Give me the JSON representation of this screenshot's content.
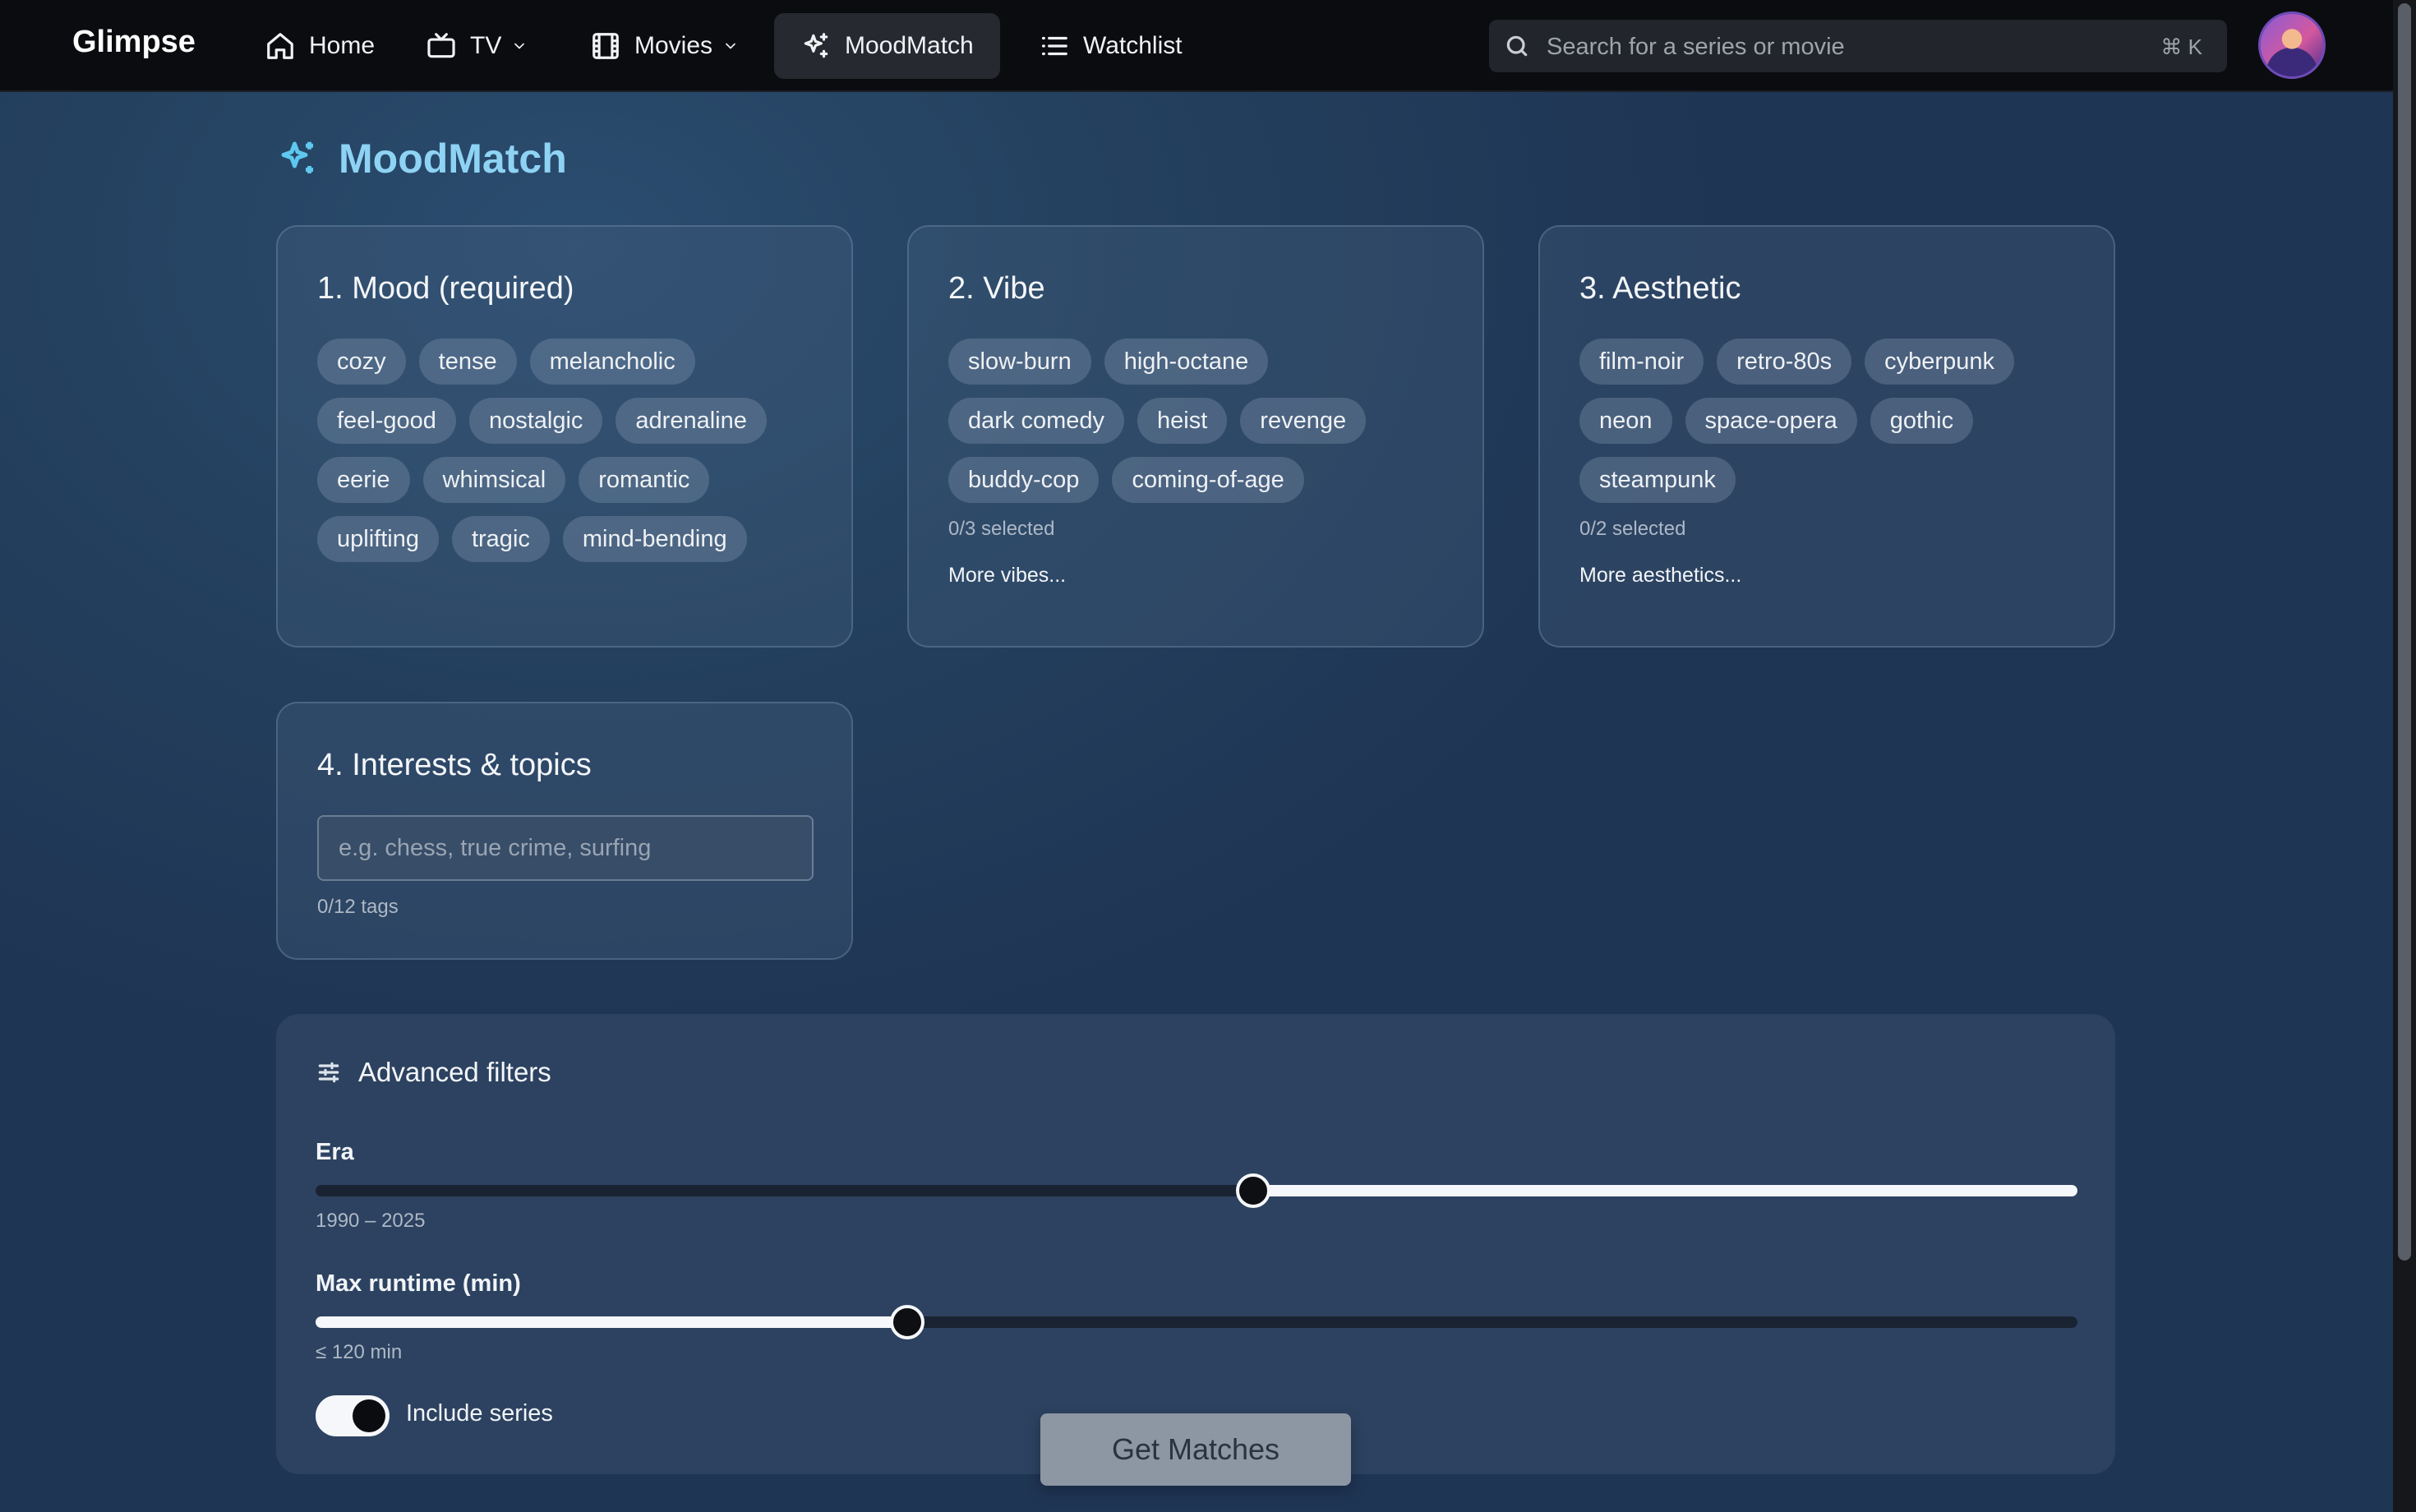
{
  "app": {
    "brand": "Glimpse"
  },
  "nav": {
    "items": [
      {
        "label": "Home",
        "icon": "home-icon"
      },
      {
        "label": "TV",
        "icon": "tv-icon",
        "dropdown": true
      },
      {
        "label": "Movies",
        "icon": "film-icon",
        "dropdown": true
      },
      {
        "label": "MoodMatch",
        "icon": "sparkles-icon",
        "active": true
      },
      {
        "label": "Watchlist",
        "icon": "list-icon"
      }
    ],
    "search": {
      "placeholder": "Search for a series or movie",
      "shortcut": "⌘ K"
    }
  },
  "page": {
    "title": "MoodMatch",
    "title_icon": "sparkles-icon"
  },
  "mood": {
    "title": "1. Mood (required)",
    "chips": [
      "cozy",
      "tense",
      "melancholic",
      "feel-good",
      "nostalgic",
      "adrenaline",
      "eerie",
      "whimsical",
      "romantic",
      "uplifting",
      "tragic",
      "mind-bending"
    ]
  },
  "vibe": {
    "title": "2. Vibe",
    "chips": [
      "slow-burn",
      "high-octane",
      "dark comedy",
      "heist",
      "revenge",
      "buddy-cop",
      "coming-of-age"
    ],
    "counter": "0/3 selected",
    "more": "More vibes..."
  },
  "aesthetic": {
    "title": "3. Aesthetic",
    "chips": [
      "film-noir",
      "retro-80s",
      "cyberpunk",
      "neon",
      "space-opera",
      "gothic",
      "steampunk"
    ],
    "counter": "0/2 selected",
    "more": "More aesthetics..."
  },
  "interests": {
    "title": "4. Interests & topics",
    "placeholder": "e.g. chess, true crime, surfing",
    "counter": "0/12 tags"
  },
  "advanced": {
    "title": "Advanced filters",
    "icon": "sliders-icon",
    "era": {
      "label": "Era",
      "value_text": "1990 – 2025",
      "fill_fraction": 0.468,
      "fill_side": "right"
    },
    "runtime": {
      "label": "Max runtime (min)",
      "value_text": "≤ 120 min",
      "fill_fraction": 0.336,
      "fill_side": "left"
    },
    "include_series": {
      "label": "Include series",
      "on": true
    }
  },
  "cta": {
    "label": "Get Matches"
  },
  "colors": {
    "accent": "#5ec8ee",
    "title": "#8fd3f4",
    "nav_bg": "#0b0c0f"
  }
}
